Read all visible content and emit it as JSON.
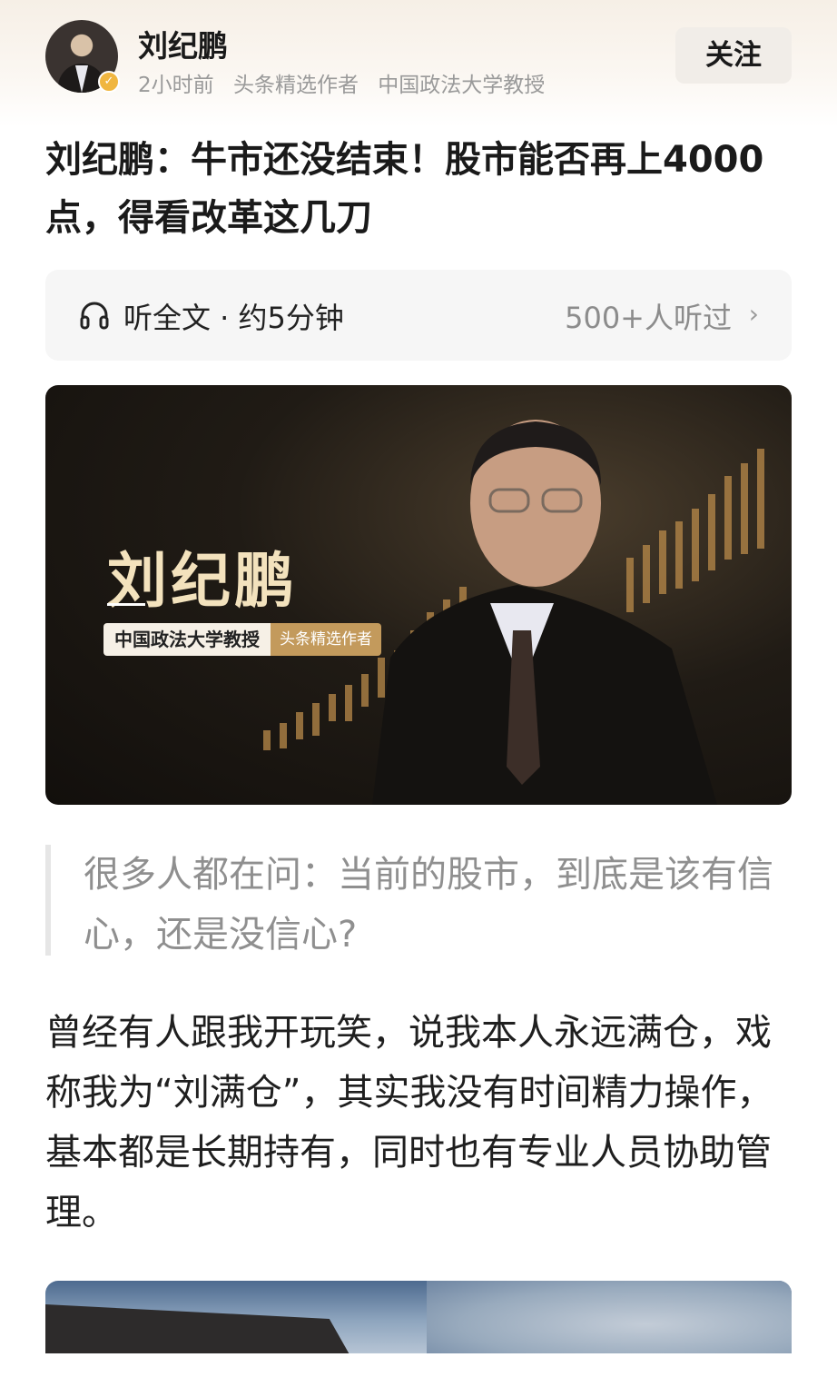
{
  "author": {
    "name": "刘纪鹏",
    "time": "2小时前",
    "badge": "头条精选作者",
    "title": "中国政法大学教授",
    "follow_label": "关注"
  },
  "article": {
    "title": "刘纪鹏：牛市还没结束！股市能否再上4000点，得看改革这几刀"
  },
  "listen": {
    "label": "听全文 · 约5分钟",
    "count": "500+人听过"
  },
  "hero": {
    "name": "刘纪鹏",
    "tag_main": "中国政法大学教授",
    "tag_sub": "头条精选作者"
  },
  "quote": "很多人都在问：当前的股市，到底是该有信心，还是没信心?",
  "body": "曾经有人跟我开玩笑，说我本人永远满仓，戏称我为“刘满仓”，其实我没有时间精力操作，基本都是长期持有，同时也有专业人员协助管理。",
  "colors": {
    "follow_bg": "#f1ede8",
    "hero_gold": "#f3e2bd",
    "tag_gold": "#c39a5c",
    "quote_text": "#8f8f8f"
  },
  "icons": {
    "listen": "headphone-icon",
    "more": "chevron-right-icon",
    "verified": "verified-badge-icon"
  }
}
